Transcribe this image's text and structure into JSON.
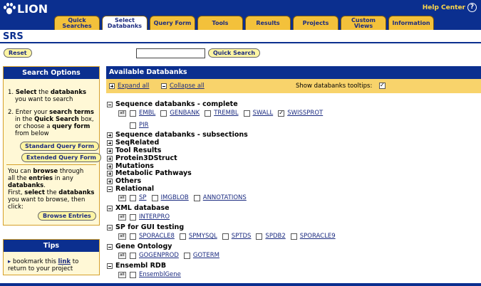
{
  "header": {
    "logo_text": "LION",
    "help_label": "Help Center",
    "help_icon": "?",
    "tabs": [
      {
        "label": "Quick Searches",
        "active": false
      },
      {
        "label": "Select Databanks",
        "active": true
      },
      {
        "label": "Query Form",
        "active": false
      },
      {
        "label": "Tools",
        "active": false
      },
      {
        "label": "Results",
        "active": false
      },
      {
        "label": "Projects",
        "active": false
      },
      {
        "label": "Custom Views",
        "active": false
      },
      {
        "label": "Information",
        "active": false
      }
    ]
  },
  "page_title": "SRS",
  "reset_label": "Reset",
  "quick_search": {
    "value": "",
    "button_label": "Quick Search"
  },
  "search_options": {
    "title": "Search Options",
    "step1_a": "1. ",
    "step1_b": "Select",
    "step1_c": " the ",
    "step1_d": "databanks",
    "step1_e": "you want to search",
    "step2_a": "2. Enter your ",
    "step2_b": "search terms",
    "step2_c": "in the ",
    "step2_d": "Quick Search",
    "step2_e": " box,",
    "step2_f": "or choose a ",
    "step2_g": "query form",
    "step2_h": "from below",
    "standard_btn": "Standard Query Form",
    "extended_btn": "Extended Query Form",
    "browse_a": "You can ",
    "browse_b": "browse",
    "browse_c": " through",
    "browse_d": "all the ",
    "browse_e": "entries",
    "browse_f": " in any",
    "browse_g": "databanks",
    "browse_h": ".",
    "browse_i": "First, ",
    "browse_j": "select",
    "browse_k": " the ",
    "browse_l": "databanks",
    "browse_m": "you want to browse, then",
    "browse_n": "click:",
    "browse_btn": "Browse Entries"
  },
  "tips": {
    "title": "Tips",
    "line1_a": "bookmark this ",
    "line1_b": "link",
    "line1_c": " to",
    "line2": "return to your project"
  },
  "databanks": {
    "title": "Available Databanks",
    "expand_all": "Expand all",
    "collapse_all": "Collapse all",
    "tooltips_label": "Show databanks tooltips:",
    "tooltips_checked": true,
    "all_label": "all",
    "categories": [
      {
        "name": "Sequence databanks - complete",
        "expanded": true,
        "dbs": [
          {
            "name": "EMBL",
            "checked": false
          },
          {
            "name": "GENBANK",
            "checked": false
          },
          {
            "name": "TREMBL",
            "checked": false
          },
          {
            "name": "SWALL",
            "checked": false
          },
          {
            "name": "SWISSPROT",
            "checked": true
          }
        ],
        "dbs2": [
          {
            "name": "PIR",
            "checked": false
          }
        ]
      },
      {
        "name": "Sequence databanks - subsections",
        "expanded": false
      },
      {
        "name": "SeqRelated",
        "expanded": false
      },
      {
        "name": "Tool Results",
        "expanded": false
      },
      {
        "name": "Protein3DStruct",
        "expanded": false
      },
      {
        "name": "Mutations",
        "expanded": false
      },
      {
        "name": "Metabolic Pathways",
        "expanded": false
      },
      {
        "name": "Others",
        "expanded": false
      },
      {
        "name": "Relational",
        "expanded": true,
        "dbs": [
          {
            "name": "SP",
            "checked": false
          },
          {
            "name": "IMGBLOB",
            "checked": false
          },
          {
            "name": "ANNOTATIONS",
            "checked": false
          }
        ]
      },
      {
        "name": "XML database",
        "expanded": true,
        "dbs": [
          {
            "name": "INTERPRO",
            "checked": false
          }
        ]
      },
      {
        "name": "SP for GUI testing",
        "expanded": true,
        "dbs": [
          {
            "name": "SPORACLE8",
            "checked": false
          },
          {
            "name": "SPMYSQL",
            "checked": false
          },
          {
            "name": "SPTDS",
            "checked": false
          },
          {
            "name": "SPDB2",
            "checked": false
          },
          {
            "name": "SPORACLE9",
            "checked": false
          }
        ]
      },
      {
        "name": "Gene Ontology",
        "expanded": true,
        "dbs": [
          {
            "name": "GOGENPROD",
            "checked": false
          },
          {
            "name": "GOTERM",
            "checked": false
          }
        ]
      },
      {
        "name": "Ensembl RDB",
        "expanded": true,
        "dbs": [
          {
            "name": "EnsemblGene",
            "checked": false
          }
        ]
      }
    ]
  }
}
